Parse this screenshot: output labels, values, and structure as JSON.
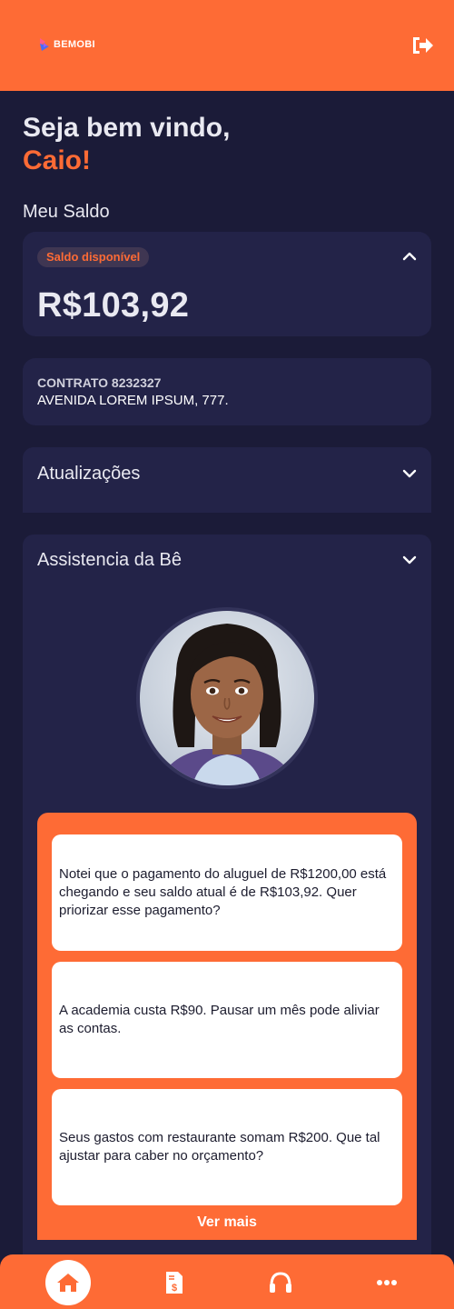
{
  "header": {
    "logo_text": "BEMOBI",
    "logout_icon": "logout-icon",
    "brand_color": "#fe6b35"
  },
  "greeting": {
    "line1": "Seja bem vindo,",
    "name": "Caio!"
  },
  "balance_section": {
    "title": "Meu Saldo",
    "badge": "Saldo disponível",
    "amount": "R$103,92",
    "collapse_icon": "chevron-up-icon"
  },
  "contract": {
    "label": "CONTRATO 8232327",
    "address": "AVENIDA LOREM IPSUM, 777."
  },
  "updates": {
    "title": "Atualizações",
    "expand_icon": "chevron-down-icon"
  },
  "assistant": {
    "title": "Assistencia da Bê",
    "expand_icon": "chevron-down-icon",
    "messages": [
      "Notei que o pagamento do aluguel de R$1200,00 está chegando e seu saldo atual é de R$103,92. Quer priorizar esse pagamento?",
      "A academia custa R$90. Pausar um mês pode aliviar as contas.",
      "Seus gastos com restaurante somam R$200. Que tal ajustar para caber no orçamento?"
    ],
    "see_more": "Ver mais"
  },
  "bottom_nav": {
    "items": [
      "home-icon",
      "invoice-icon",
      "headset-icon",
      "more-icon"
    ],
    "active": "home-icon"
  }
}
